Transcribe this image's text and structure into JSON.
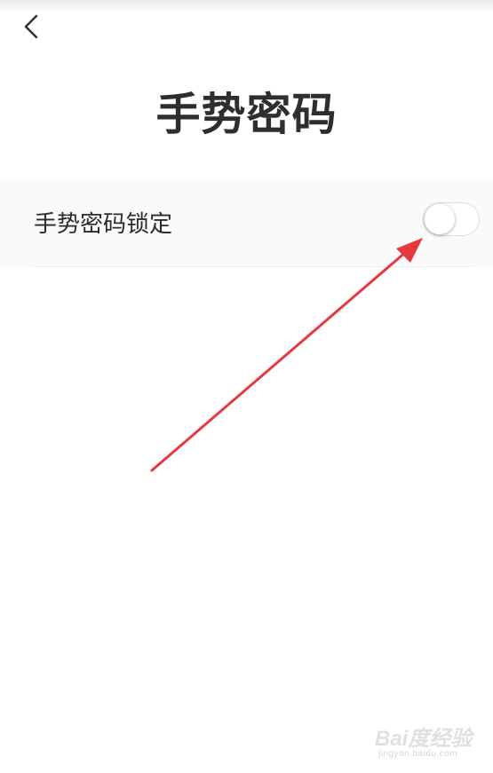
{
  "header": {
    "back_icon": "chevron-left-icon",
    "title": "手势密码"
  },
  "settings": {
    "gesture_lock": {
      "label": "手势密码锁定",
      "enabled": false
    }
  },
  "annotation": {
    "arrow_color": "#e8383d"
  },
  "watermark": {
    "brand_text": "Bai度经验",
    "url": "jingyan.baidu.com"
  },
  "colors": {
    "title_text": "#2e2e2e",
    "row_background": "#fafafa",
    "divider": "#ececec"
  }
}
